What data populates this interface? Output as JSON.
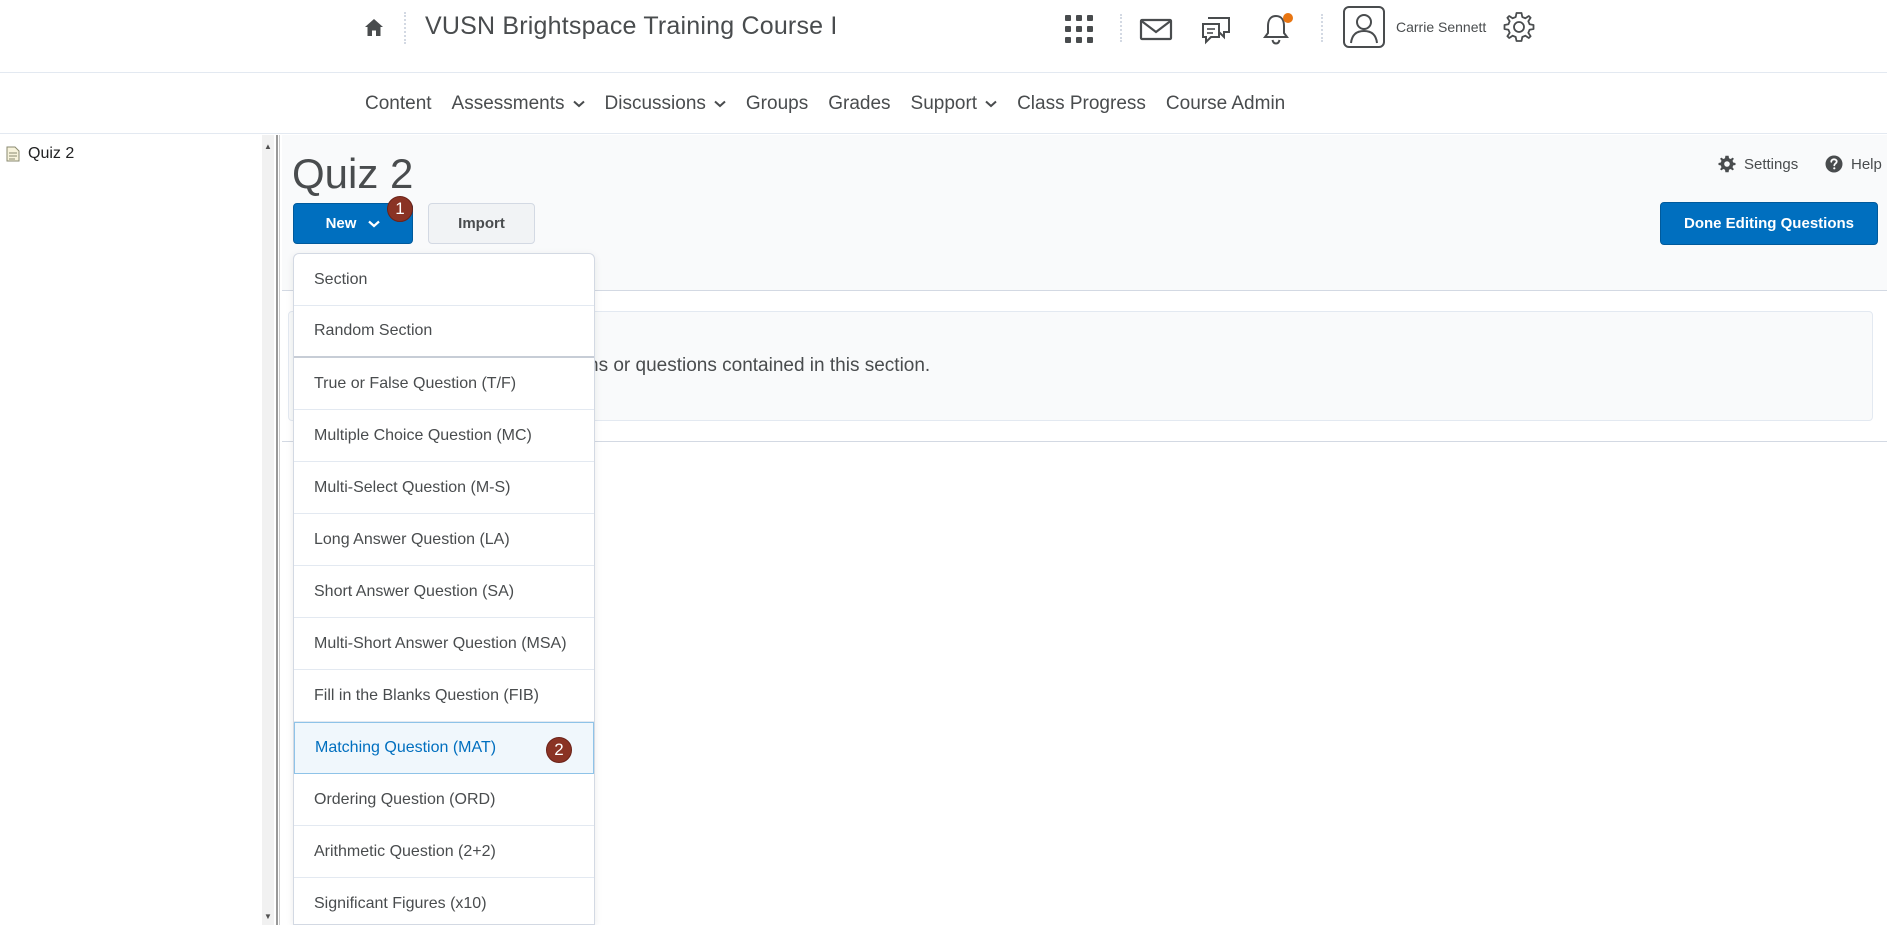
{
  "header": {
    "course_title": "VUSN Brightspace Training Course I",
    "user_name": "Carrie Sennett",
    "icons": [
      "home-icon",
      "apps-grid-icon",
      "email-icon",
      "chat-icon",
      "notification-bell-icon",
      "user-avatar-icon",
      "gear-icon"
    ],
    "notification_dot_color": "#e87511"
  },
  "nav": {
    "items": [
      {
        "label": "Content",
        "has_menu": false
      },
      {
        "label": "Assessments",
        "has_menu": true
      },
      {
        "label": "Discussions",
        "has_menu": true
      },
      {
        "label": "Groups",
        "has_menu": false
      },
      {
        "label": "Grades",
        "has_menu": false
      },
      {
        "label": "Support",
        "has_menu": true
      },
      {
        "label": "Class Progress",
        "has_menu": false
      },
      {
        "label": "Course Admin",
        "has_menu": false
      }
    ]
  },
  "tree": {
    "items": [
      {
        "label": "Quiz 2"
      }
    ]
  },
  "page": {
    "title": "Quiz 2",
    "new_button": "New",
    "import_button": "Import",
    "done_button": "Done Editing Questions",
    "settings_link": "Settings",
    "help_link": "Help",
    "section_text": "ns or questions contained in this section."
  },
  "badges": {
    "new": "1",
    "matching": "2",
    "color": "#8a3324"
  },
  "dropdown": {
    "items": [
      {
        "label": "Section"
      },
      {
        "label": "Random Section"
      },
      {
        "label": "True or False Question (T/F)"
      },
      {
        "label": "Multiple Choice Question (MC)"
      },
      {
        "label": "Multi-Select Question (M-S)"
      },
      {
        "label": "Long Answer Question (LA)"
      },
      {
        "label": "Short Answer Question (SA)"
      },
      {
        "label": "Multi-Short Answer Question (MSA)"
      },
      {
        "label": "Fill in the Blanks Question (FIB)"
      },
      {
        "label": "Matching Question (MAT)"
      },
      {
        "label": "Ordering Question (ORD)"
      },
      {
        "label": "Arithmetic Question (2+2)"
      },
      {
        "label": "Significant Figures (x10)"
      }
    ],
    "active_index": 9
  },
  "colors": {
    "primary": "#006fbf",
    "text": "#494c4e"
  }
}
